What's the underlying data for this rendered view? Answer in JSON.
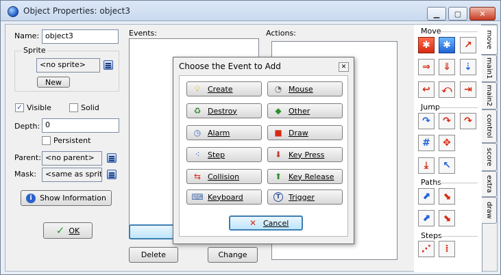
{
  "window": {
    "title": "Object Properties: object3"
  },
  "left": {
    "name_label": "Name:",
    "name_value": "object3",
    "sprite_group": "Sprite",
    "sprite_value": "<no sprite>",
    "new_button": "New",
    "visible_label": "Visible",
    "visible_checked": true,
    "solid_label": "Solid",
    "solid_checked": false,
    "depth_label": "Depth:",
    "depth_value": "0",
    "persistent_label": "Persistent",
    "persistent_checked": false,
    "parent_label": "Parent:",
    "parent_value": "<no parent>",
    "mask_label": "Mask:",
    "mask_value": "<same as sprite>",
    "show_info_button": "Show Information",
    "ok_button": "OK"
  },
  "events_panel": {
    "label": "Events:",
    "delete_button": "Delete",
    "change_button": "Change"
  },
  "actions_panel": {
    "label": "Actions:"
  },
  "palette": {
    "sections": [
      {
        "title": "Move"
      },
      {
        "title": "Jump"
      },
      {
        "title": "Paths"
      },
      {
        "title": "Steps"
      }
    ]
  },
  "tabs": [
    "move",
    "main1",
    "main2",
    "control",
    "score",
    "extra",
    "draw"
  ],
  "dialog": {
    "title": "Choose the Event to Add",
    "events": [
      {
        "label": "Create",
        "icon": "lightbulb-icon"
      },
      {
        "label": "Mouse",
        "icon": "mouse-icon"
      },
      {
        "label": "Destroy",
        "icon": "trash-icon"
      },
      {
        "label": "Other",
        "icon": "diamond-icon"
      },
      {
        "label": "Alarm",
        "icon": "clock-icon"
      },
      {
        "label": "Draw",
        "icon": "paint-icon"
      },
      {
        "label": "Step",
        "icon": "footsteps-icon"
      },
      {
        "label": "Key Press",
        "icon": "keyboard-down-icon"
      },
      {
        "label": "Collision",
        "icon": "collision-arrows-icon"
      },
      {
        "label": "Key Release",
        "icon": "keyboard-up-icon"
      },
      {
        "label": "Keyboard",
        "icon": "keyboard-icon"
      },
      {
        "label": "Trigger",
        "icon": "trigger-icon"
      }
    ],
    "cancel_button": "Cancel"
  }
}
